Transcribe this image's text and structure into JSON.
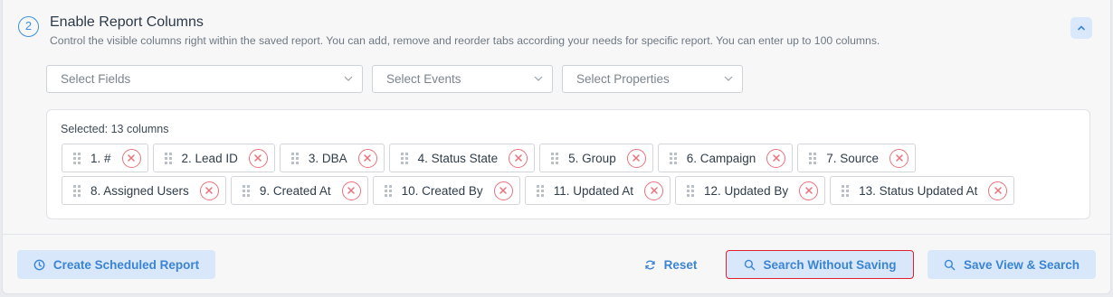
{
  "section": {
    "step_number": "2",
    "title": "Enable Report Columns",
    "description": "Control the visible columns right within the saved report. You can add, remove and reorder tabs according your needs for specific report. You can enter up to 100 columns."
  },
  "selects": {
    "fields_placeholder": "Select Fields",
    "events_placeholder": "Select Events",
    "properties_placeholder": "Select Properties"
  },
  "selected": {
    "count_text": "Selected: 13 columns",
    "columns": [
      "1. #",
      "2. Lead ID",
      "3. DBA",
      "4. Status State",
      "5. Group",
      "6. Campaign",
      "7. Source",
      "8. Assigned Users",
      "9. Created At",
      "10. Created By",
      "11. Updated At",
      "12. Updated By",
      "13. Status Updated At"
    ]
  },
  "footer": {
    "create_scheduled_label": "Create Scheduled Report",
    "reset_label": "Reset",
    "search_without_saving_label": "Search Without Saving",
    "save_view_label": "Save View & Search"
  },
  "colors": {
    "accent": "#3b84d3",
    "button_bg": "#d8e8fa",
    "remove_red": "#e9717a",
    "highlight_border": "#e0202e"
  }
}
